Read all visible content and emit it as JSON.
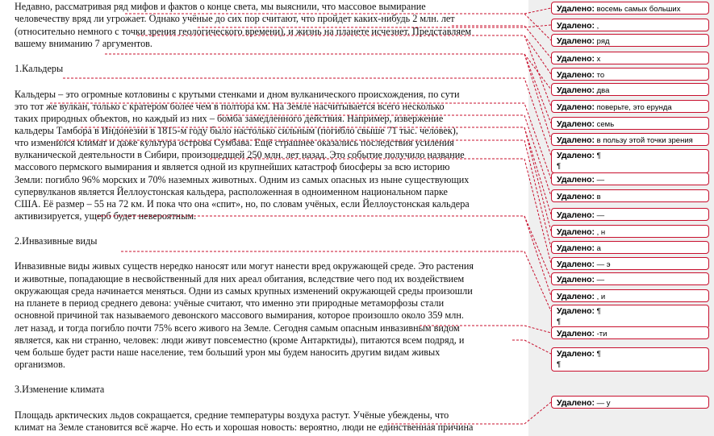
{
  "document": {
    "intro": [
      "Недавно, рассматривая ряд мифов и фактов о конце света, мы выяснили, что массовое вымирание",
      "человечеству вряд ли угрожает. Однако учёные до сих пор считают, что пройдет каких-нибудь 2 млн. лет",
      "(относительно немного с точки зрения геологического времени), и жизнь на планете исчезнет. Представляем",
      "вашему вниманию 7 аргументов."
    ],
    "section1_title": "1.Кальдеры",
    "section1": [
      "Кальдеры – это огромные котловины с крутыми стенками и дном вулканического происхождения, по сути",
      "это тот же вулкан, только с кратером более чем в полтора км. На Земле насчитывается всего несколько",
      "таких природных объектов, но каждый из них – бомба замедленного действия. Например, извержение",
      "кальдеры Тамбора в Индонезии в 1815-м году было настолько сильным (погибло свыше 71 тыс. человек),",
      "что изменился климат и даже культура острова Сумбава. Ещё страшнее оказались последствия усиления",
      "вулканической деятельности в Сибири, произошедшей 250 млн. лет назад. Это событие получило название",
      "массового пермского вымирания и является одной из крупнейших катастроф биосферы за всю историю",
      "Земли: погибло 96% морских и 70% наземных животных. Одним из самых опасных из ныне существующих",
      "супервулканов является Йеллоустонская кальдера, расположенная в одноименном национальном парке",
      "США. Её размер – 55 на 72 км. И пока что она «спит», но, по словам учёных, если Йеллоустонская кальдера",
      "активизируется, ущерб будет невероятным."
    ],
    "section2_title": "2.Инвазивные виды",
    "section2": [
      "Инвазивные виды живых существ нередко наносят или могут нанести вред окружающей среде. Это растения",
      "и животные, попадающие в несвойственный для них ареал обитания, вследствие чего под их воздействием",
      "окружающая среда начинается меняться. Одни из самых крупных изменений окружающей среды произошли",
      "на планете в период среднего девона: учёные считают, что именно эти природные метаморфозы стали",
      "основной причиной так называемого девонского массового вымирания, которое произошло около 359 млн.",
      "лет назад, и тогда погибло почти 75% всего живого на Земле. Сегодня самым опасным инвазивным видом",
      "является, как ни странно, человек: люди живут повсеместно (кроме Антарктиды), питаются всем подряд, и",
      "чем больше будет расти наше население, тем больший урон мы будем наносить другим видам живых",
      "организмов."
    ],
    "section3_title": "3.Изменение  климата",
    "section3": [
      "Площадь арктических льдов сокращается, средние температуры воздуха растут. Учёные убеждены, что",
      "климат на Земле становится всё жарче. Но есть и хорошая новость: вероятно, люди не единственная причина"
    ]
  },
  "balloons": [
    {
      "label": "Удалено:",
      "text": "восемь самых больших"
    },
    {
      "label": "Удалено:",
      "text": ","
    },
    {
      "label": "Удалено:",
      "text": "ряд"
    },
    {
      "label": "Удалено:",
      "text": "х"
    },
    {
      "label": "Удалено:",
      "text": "то"
    },
    {
      "label": "Удалено:",
      "text": "два"
    },
    {
      "label": "Удалено:",
      "text": "поверьте, это ерунда"
    },
    {
      "label": "Удалено:",
      "text": "семь"
    },
    {
      "label": "Удалено:",
      "text": "в пользу этой точки зрения"
    },
    {
      "label": "Удалено:",
      "text": "¶",
      "line2": "¶"
    },
    {
      "label": "Удалено:",
      "text": "—"
    },
    {
      "label": "Удалено:",
      "text": "в"
    },
    {
      "label": "Удалено:",
      "text": "—"
    },
    {
      "label": "Удалено:",
      "text": ", н"
    },
    {
      "label": "Удалено:",
      "text": "а"
    },
    {
      "label": "Удалено:",
      "text": "— э"
    },
    {
      "label": "Удалено:",
      "text": "—"
    },
    {
      "label": "Удалено:",
      "text": ", и"
    },
    {
      "label": "Удалено:",
      "text": "¶",
      "line2": "¶"
    },
    {
      "label": "Удалено:",
      "text": "-ти"
    },
    {
      "label": "Удалено:",
      "text": "¶",
      "line2": "¶"
    },
    {
      "label": "Удалено:",
      "text": "— у"
    }
  ],
  "colors": {
    "revision": "#c8102e",
    "margin_bg": "#efefef"
  }
}
